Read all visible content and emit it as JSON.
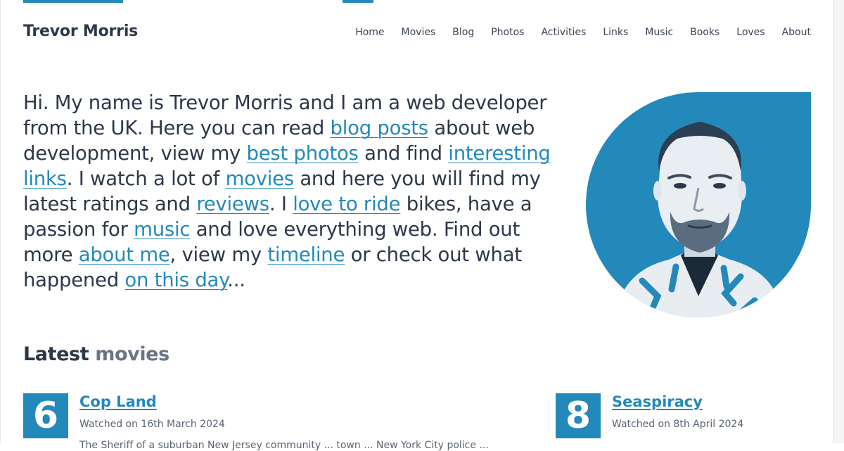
{
  "colors": {
    "accent": "#2389ba",
    "text": "#2c3848",
    "muted": "#6a7584"
  },
  "site": {
    "title": "Trevor Morris"
  },
  "nav": [
    "Home",
    "Movies",
    "Blog",
    "Photos",
    "Activities",
    "Links",
    "Music",
    "Books",
    "Loves",
    "About"
  ],
  "intro": {
    "t1": "Hi. My name is Trevor Morris and I am a web developer from the UK. Here you can read ",
    "link_blog": "blog posts",
    "t2": " about web development, view my ",
    "link_photos": "best photos",
    "t3": " and find ",
    "link_links": "interesting links",
    "t4": ". I watch a lot of ",
    "link_movies": "movies",
    "t5": " and here you will find my latest ratings and ",
    "link_reviews": "reviews",
    "t6": ". I ",
    "link_ride": "love to ride",
    "t7": " bikes, have a passion for ",
    "link_music": "music",
    "t8": " and love everything web. Find out more ",
    "link_about": "about me",
    "t9": ", view my ",
    "link_timeline": "timeline",
    "t10": " or check out what happened ",
    "link_day": "on this day",
    "t11": "..."
  },
  "latest": {
    "title_bold": "Latest",
    "title_rest": "movies"
  },
  "movies": [
    {
      "rating": "6",
      "title": "Cop Land",
      "watched": "Watched on 16th March 2024",
      "excerpt": "The Sheriff of a suburban New Jersey community ... town ... New York City police ..."
    },
    {
      "rating": "8",
      "title": "Seaspiracy",
      "watched": "Watched on 8th April 2024",
      "excerpt": ""
    }
  ]
}
